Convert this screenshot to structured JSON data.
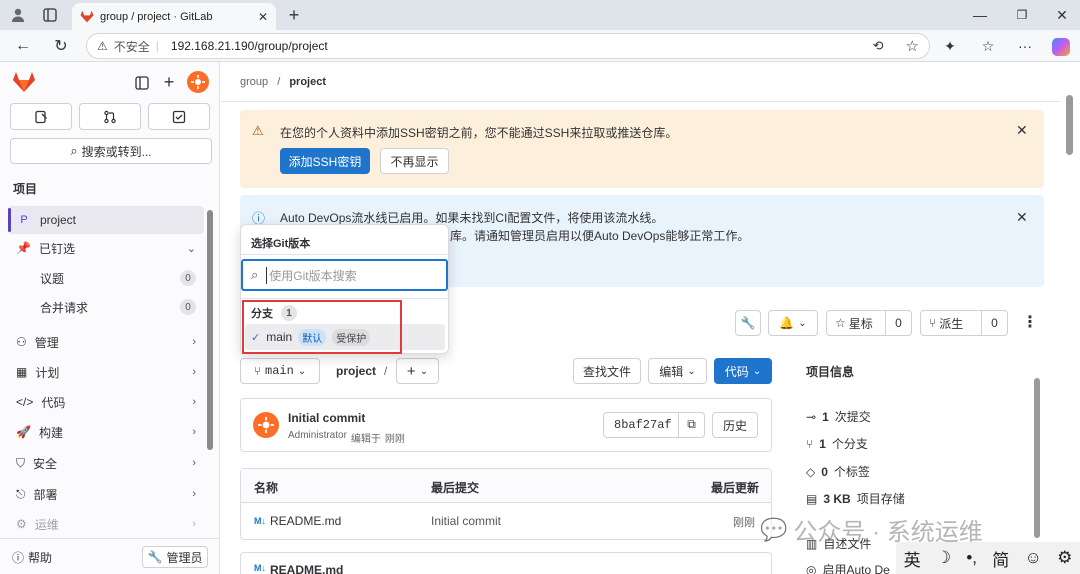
{
  "browser": {
    "tab_title": "group / project · GitLab",
    "new_tab": "+",
    "address": {
      "security_label": "不安全",
      "url": "192.168.21.190/group/project"
    }
  },
  "sidebar": {
    "search_label": "搜索或转到...",
    "section_title": "项目",
    "project_badge": "P",
    "project_name": "project",
    "pinned": {
      "label": "已钉选",
      "items": [
        {
          "label": "议题",
          "count": "0"
        },
        {
          "label": "合并请求",
          "count": "0"
        }
      ]
    },
    "items": [
      {
        "label": "管理",
        "icon": "admin-icon"
      },
      {
        "label": "计划",
        "icon": "calendar-icon"
      },
      {
        "label": "代码",
        "icon": "code-icon"
      },
      {
        "label": "构建",
        "icon": "rocket-icon"
      },
      {
        "label": "安全",
        "icon": "shield-icon"
      },
      {
        "label": "部署",
        "icon": "deploy-icon"
      },
      {
        "label": "运维",
        "icon": "monitor-icon"
      }
    ],
    "help_label": "帮助",
    "admin_label": "管理员"
  },
  "breadcrumb": {
    "group": "group",
    "sep": "/",
    "project": "project"
  },
  "ssh_alert": {
    "text": "在您的个人资料中添加SSH密钥之前，您不能通过SSH来拉取或推送仓库。",
    "add_button": "添加SSH密钥",
    "dismiss_button": "不再显示"
  },
  "devops_alert": {
    "line1": "Auto DevOps流水线已启用。如果未找到CI配置文件，将使用该流水线。",
    "line2": "库。请通知管理员启用以便Auto DevOps能够正常工作。"
  },
  "project_actions": {
    "star_label": "星标",
    "star_count": "0",
    "fork_label": "派生",
    "fork_count": "0"
  },
  "ref_selector": {
    "branch": "main",
    "path": "project",
    "path_sep": "/",
    "add": "+",
    "find_file": "查找文件",
    "edit": "编辑",
    "code": "代码"
  },
  "popover": {
    "title": "选择Git版本",
    "search_placeholder": "使用Git版本搜索",
    "branches_label": "分支",
    "branches_count": "1",
    "branch": {
      "name": "main",
      "default_badge": "默认",
      "protected_badge": "受保护"
    }
  },
  "commit": {
    "title": "Initial commit",
    "author": "Administrator",
    "meta": "编辑于",
    "time": "刚刚",
    "sha": "8baf27af",
    "history": "历史"
  },
  "files_table": {
    "headers": [
      "名称",
      "最后提交",
      "最后更新"
    ],
    "rows": [
      {
        "name": "README.md",
        "commit": "Initial commit",
        "updated": "刚刚"
      }
    ]
  },
  "readme_title": "README.md",
  "project_info": {
    "title": "项目信息",
    "items": [
      {
        "icon": "commit-icon",
        "value": "1",
        "label": "次提交"
      },
      {
        "icon": "branch-icon",
        "value": "1",
        "label": "个分支"
      },
      {
        "icon": "tag-icon",
        "value": "0",
        "label": "个标签"
      },
      {
        "icon": "storage-icon",
        "value": "3 KB",
        "label": "项目存储"
      }
    ],
    "more1": "自述文件",
    "more2": "启用Auto De"
  },
  "watermark": "公众号 · 系统运维",
  "ime": [
    "英",
    "☽",
    "•,",
    "简",
    "☺",
    "⚙"
  ],
  "colors": {
    "primary": "#1f75cb",
    "warn_bg": "#fcf0dc",
    "info_bg": "#e9f3fc",
    "gitlab_orange": "#e24329"
  }
}
